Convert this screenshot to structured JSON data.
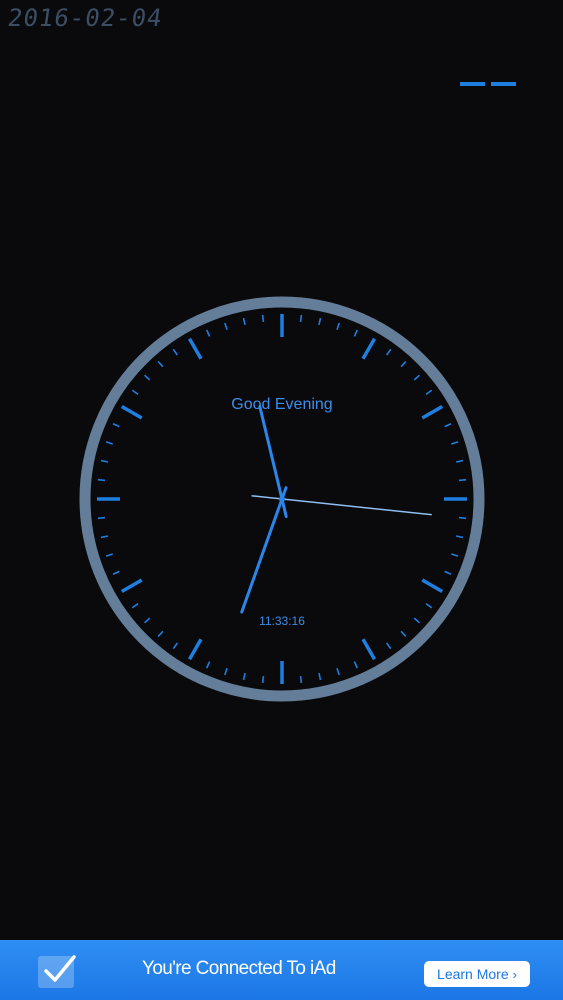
{
  "status": {
    "date": "2016-02-04"
  },
  "clock": {
    "greeting": "Good Evening",
    "time": "11:33:16",
    "hours": 11,
    "minutes": 33,
    "seconds": 16,
    "colors": {
      "ring": "#647d99",
      "ticks": "#1e7fe0",
      "hands": "#2a86ea",
      "text": "#3d8ee8"
    }
  },
  "menu": {
    "icon": "menu-dash-icon"
  },
  "ad_banner": {
    "message": "You're Connected To iAd",
    "button_label": "Learn More",
    "icon": "checkmark-icon",
    "button_chevron": "›",
    "colors": {
      "background": "#1f7ee8",
      "button_text": "#1c77e6"
    }
  }
}
